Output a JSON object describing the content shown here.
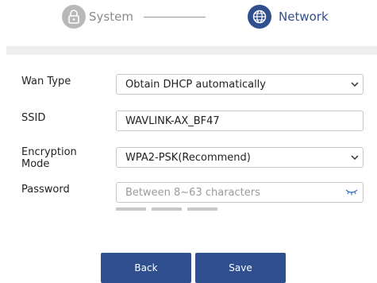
{
  "stepper": {
    "step1": {
      "label": "System",
      "icon": "lock-icon",
      "state": "completed"
    },
    "step2": {
      "label": "Network",
      "icon": "globe-icon",
      "state": "active"
    }
  },
  "form": {
    "wan_type": {
      "label": "Wan Type",
      "value": "Obtain DHCP automatically"
    },
    "ssid": {
      "label": "SSID",
      "value": "WAVLINK-AX_BF47"
    },
    "encryption": {
      "label": "Encryption Mode",
      "value": "WPA2-PSK(Recommend)"
    },
    "password": {
      "label": "Password",
      "value": "",
      "placeholder": "Between 8~63 characters",
      "visibility_icon": "eye-closed-icon"
    }
  },
  "buttons": {
    "back": "Back",
    "save": "Save"
  },
  "colors": {
    "accent": "#2f4f8f",
    "inactive": "#b8b8b8",
    "band": "#eeeeee"
  }
}
